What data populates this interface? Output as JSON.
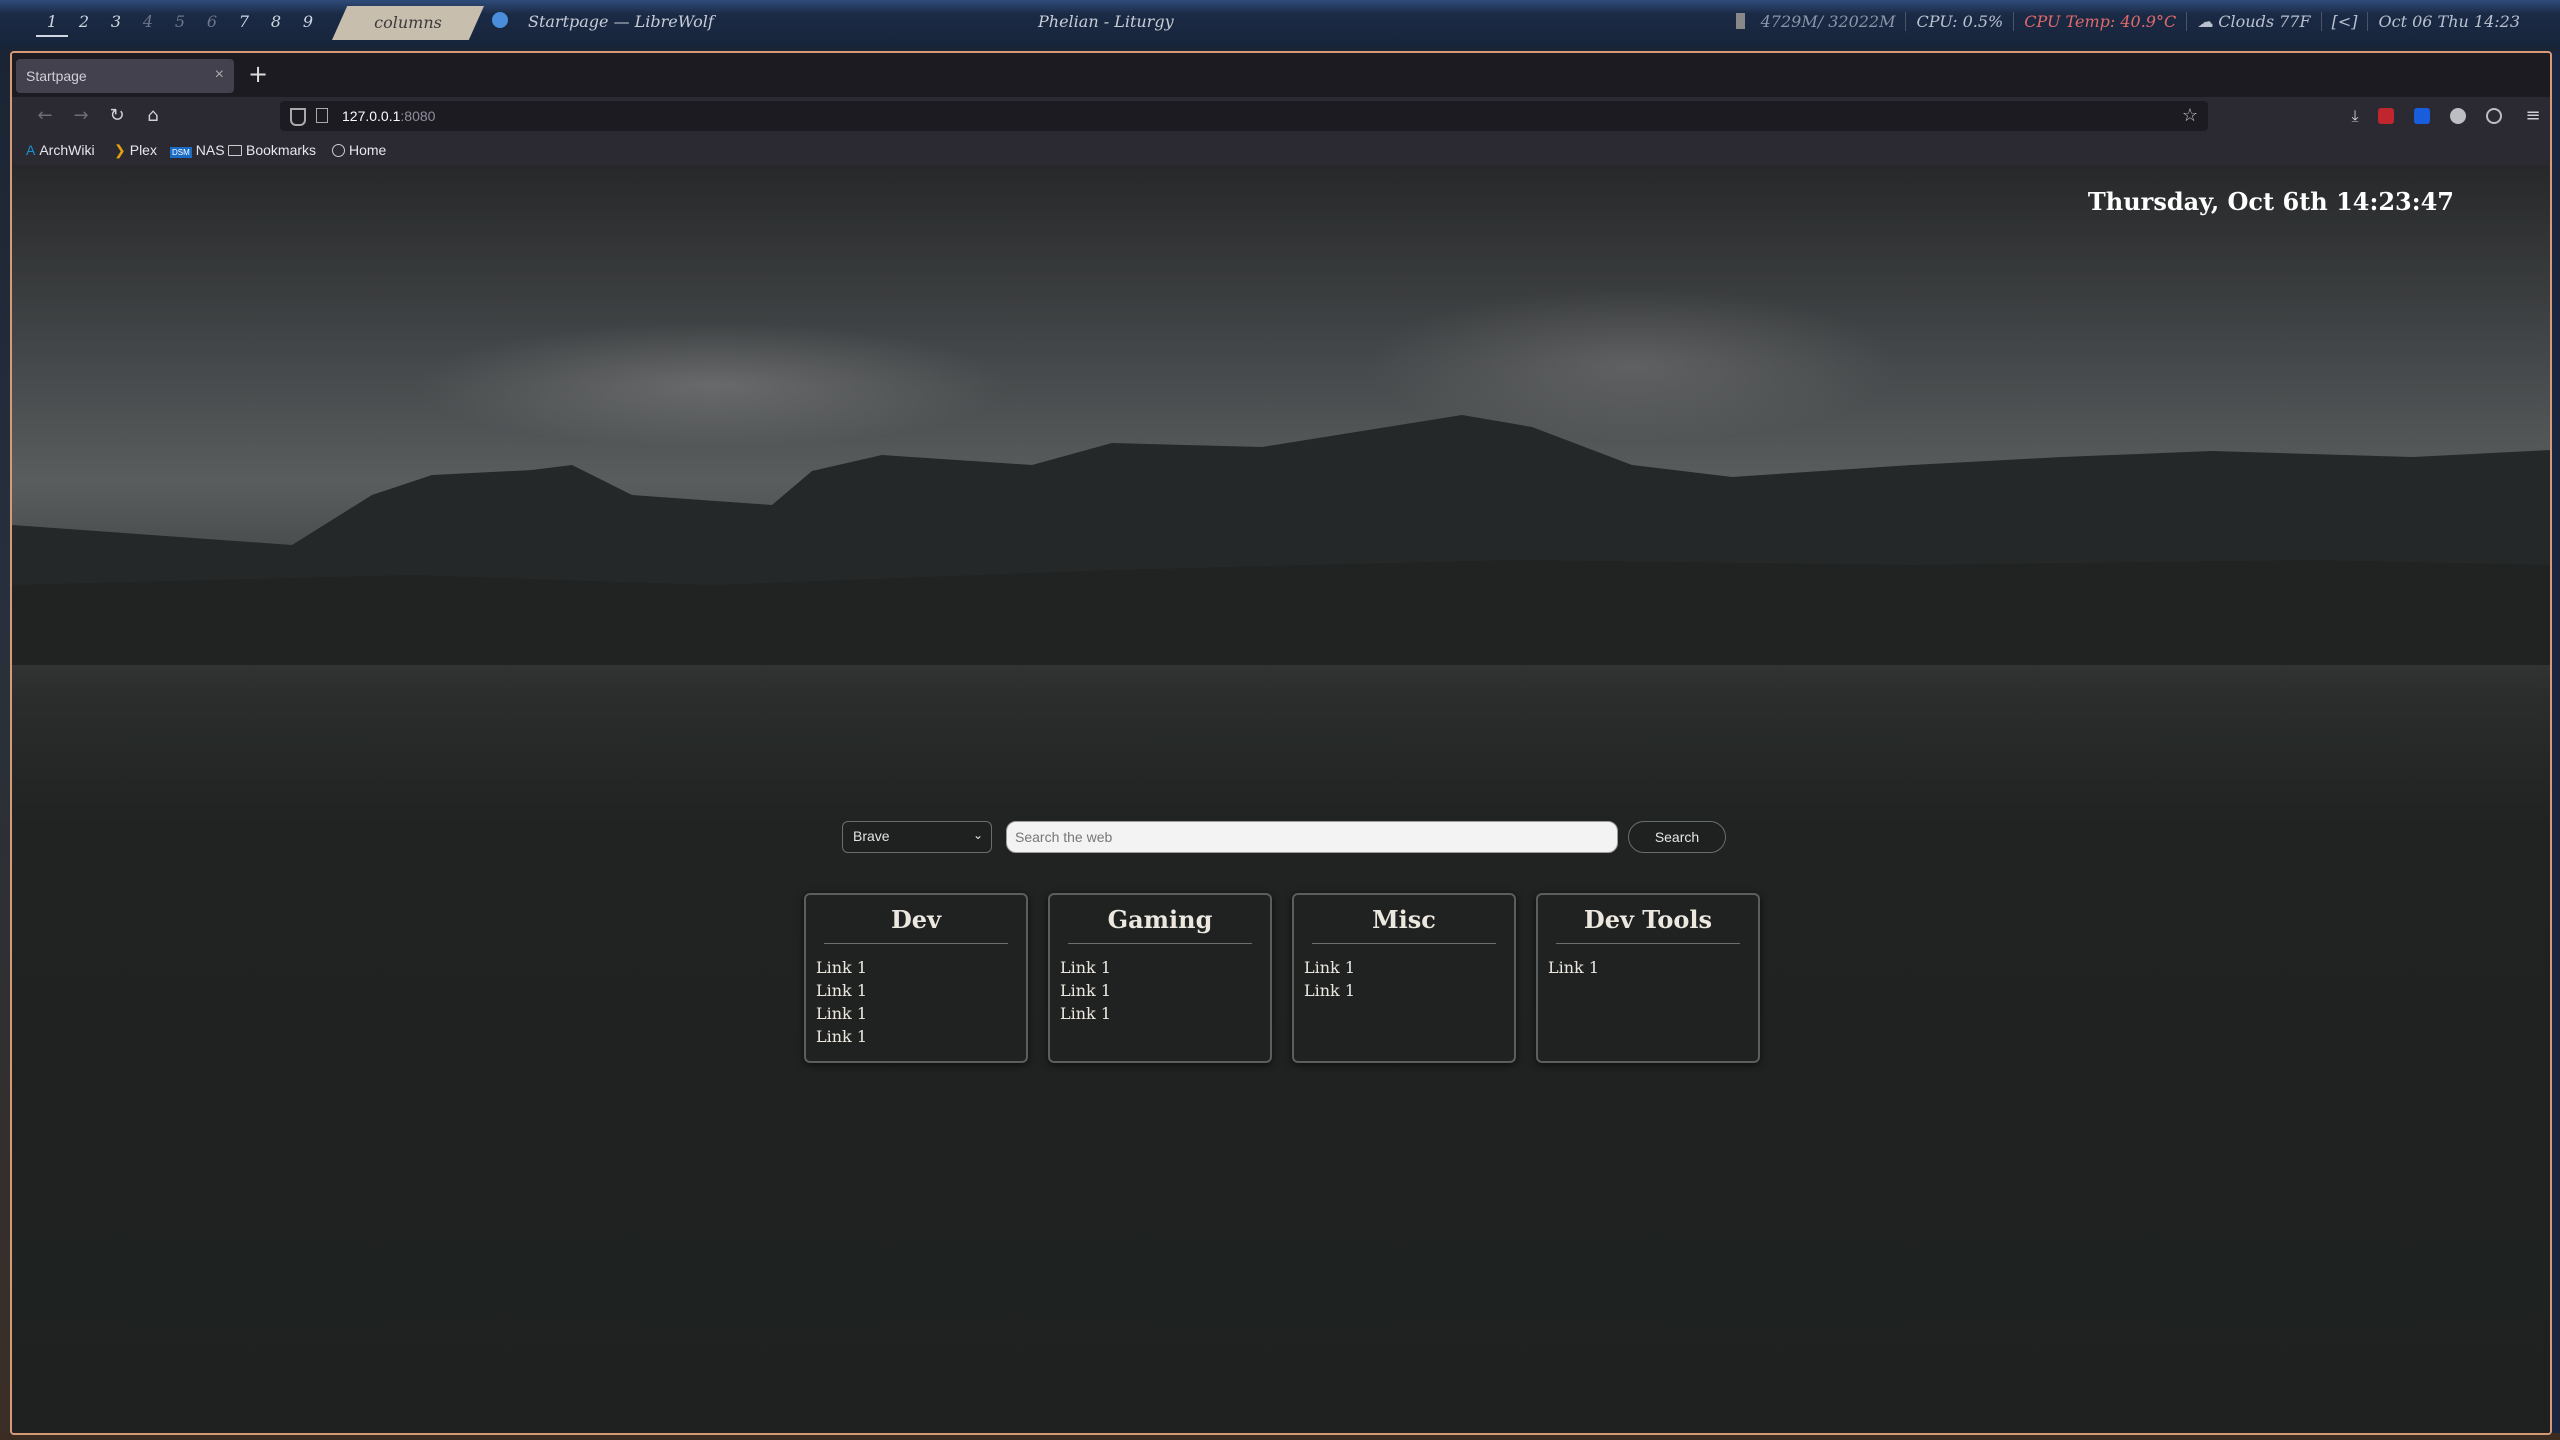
{
  "system_bar": {
    "workspaces": [
      "1",
      "2",
      "3",
      "4",
      "5",
      "6",
      "7",
      "8",
      "9"
    ],
    "layout": "columns",
    "window_title": "Startpage — LibreWolf",
    "now_playing": "Phelian - Liturgy",
    "memory": "4729M/ 32022M",
    "cpu": "CPU: 0.5%",
    "cpu_temp": "CPU Temp: 40.9°C",
    "weather": "☁ Clouds  77F",
    "kbd": "[<]",
    "datetime": "Oct 06 Thu 14:23"
  },
  "browser": {
    "tab_title": "Startpage",
    "tab_close": "×",
    "new_tab": "+",
    "url_host": "127.0.0.1",
    "url_port": ":8080",
    "bookmarks": [
      {
        "label": "ArchWiki",
        "icon": "A"
      },
      {
        "label": "Plex",
        "icon": "❯"
      },
      {
        "label": "NAS",
        "icon": "DSM"
      },
      {
        "label": "Bookmarks",
        "icon": "folder"
      },
      {
        "label": "Home",
        "icon": "globe"
      }
    ]
  },
  "page": {
    "clock": "Thursday, Oct 6th 14:23:47",
    "search": {
      "engine": "Brave",
      "placeholder": "Search the web",
      "button": "Search"
    },
    "cards": [
      {
        "title": "Dev",
        "links": [
          "Link 1",
          "Link 1",
          "Link 1",
          "Link 1"
        ]
      },
      {
        "title": "Gaming",
        "links": [
          "Link 1",
          "Link 1",
          "Link 1"
        ]
      },
      {
        "title": "Misc",
        "links": [
          "Link 1",
          "Link 1"
        ]
      },
      {
        "title": "Dev Tools",
        "links": [
          "Link 1"
        ]
      }
    ]
  },
  "colors": {
    "window_border": "#d79a77",
    "cpu_temp": "#e06a6a",
    "card_bg": "#1f2221"
  }
}
